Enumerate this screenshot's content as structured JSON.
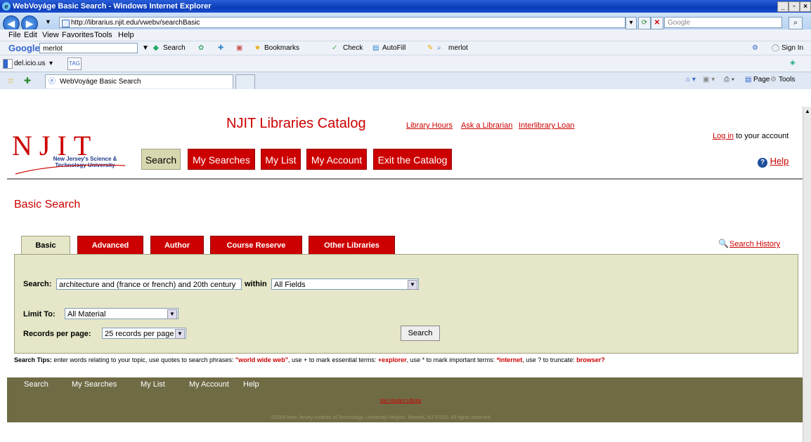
{
  "window": {
    "title": "WebVoyáge Basic Search - Windows Internet Explorer"
  },
  "browser": {
    "url": "http://librarius.njit.edu/vwebv/searchBasic",
    "search_placeholder": "Google",
    "menu": [
      "File",
      "Edit",
      "View",
      "Favorites",
      "Tools",
      "Help"
    ],
    "google_toolbar": {
      "logo": "Google",
      "query": "merlot",
      "search_label": "Search",
      "bookmarks_label": "Bookmarks",
      "check_label": "Check",
      "autofill_label": "AutoFill",
      "highlight_label": "merlot",
      "signin_label": "Sign In"
    },
    "delicious": {
      "label": "del.icio.us",
      "tag_label": "TAG"
    },
    "tab_title": "WebVoyáge Basic Search",
    "command_bar": {
      "page_label": "Page",
      "tools_label": "Tools"
    }
  },
  "site": {
    "title": "NJIT Libraries Catalog",
    "top_links": [
      "Library Hours",
      "Ask a Librarian",
      "Interlibrary Loan"
    ],
    "logo": {
      "letters": "NJIT",
      "subtitle_1": "New Jersey's Science &",
      "subtitle_2": "Technology University"
    },
    "nav": [
      "Search",
      "My Searches",
      "My List",
      "My Account",
      "Exit the Catalog"
    ],
    "login_link": "Log in",
    "login_rest": " to your account",
    "help": "Help"
  },
  "search": {
    "heading": "Basic Search",
    "tabs": [
      "Basic",
      "Advanced",
      "Author",
      "Course Reserve",
      "Other Libraries"
    ],
    "history_link": "Search History",
    "search_label": "Search:",
    "query": "architecture and (france or french) and 20th century",
    "within_label": "within",
    "within_value": "All Fields",
    "limit_label": "Limit To:",
    "limit_value": "All Material",
    "records_label": "Records per page:",
    "records_value": "25 records per page",
    "button": "Search"
  },
  "tips": {
    "label": "Search Tips:",
    "t1": " enter words relating to your topic, use quotes to search phrases: ",
    "e1": "\"world wide web\"",
    "t2": ", use + to mark essential terms: ",
    "e2": "+explorer",
    "t3": ", use * to mark important terms: ",
    "e3": "*internet",
    "t4": ", use ? to truncate: ",
    "e4": "browser?"
  },
  "footer": {
    "links": [
      "Search",
      "My Searches",
      "My List",
      "My Account",
      "Help"
    ],
    "library": "Van Houten Library",
    "copyright": "©2009 New Jersey Institute of Technology, University Heights, Newark, NJ 07102. All rights reserved."
  }
}
